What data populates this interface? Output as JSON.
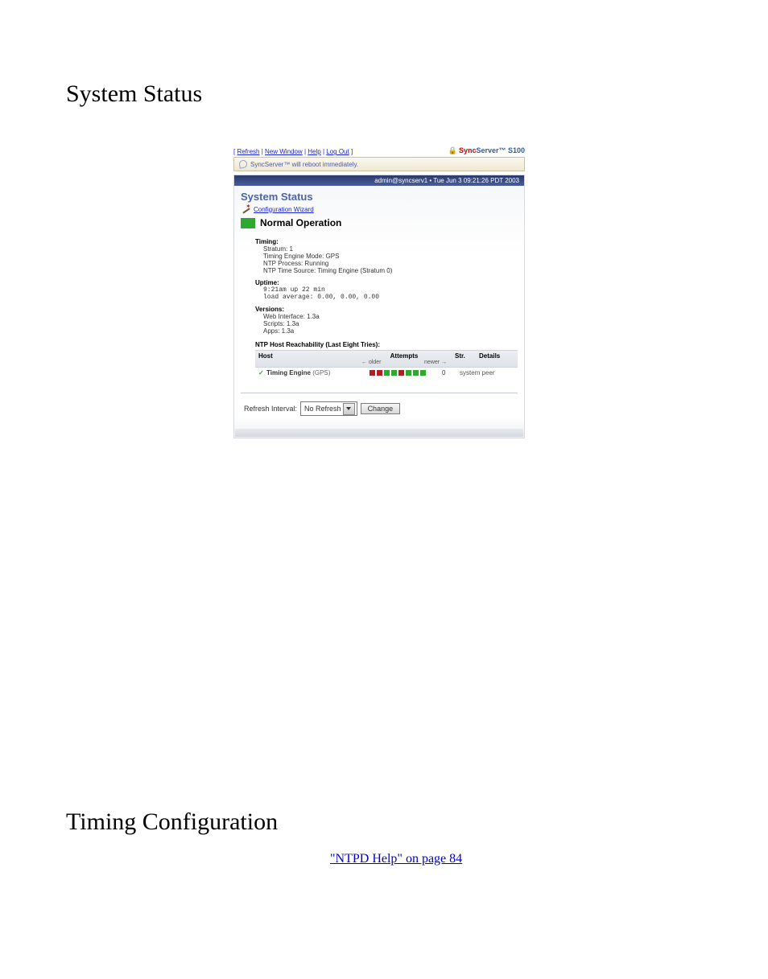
{
  "headings": {
    "system_status": "System Status",
    "timing_configuration": "Timing Configuration"
  },
  "body_link": {
    "text": "\"NTPD Help\" on page 84"
  },
  "shot": {
    "top_links": {
      "lb": "[ ",
      "refresh": "Refresh",
      "sep": " | ",
      "new_window": "New Window",
      "help": "Help",
      "log_out": "Log Out",
      "rb": " ]"
    },
    "brand": {
      "p1": "Sync",
      "p2": "Server™ S100"
    },
    "reboot_msg": "SyncServer™ will reboot immediately.",
    "admin_bar": "admin@syncserv1  •  Tue Jun 3 09:21:26 PDT 2003",
    "title": "System Status",
    "config_wizard": "Configuration Wizard",
    "normal_op": "Normal Operation",
    "timing": {
      "hdg": "Timing:",
      "stratum": "Stratum: 1",
      "mode": "Timing Engine Mode: GPS",
      "proc": "NTP Process: Running",
      "src": "NTP Time Source: Timing Engine (Stratum 0)"
    },
    "uptime": {
      "hdg": "Uptime:",
      "l1": "9:21am  up 22 min",
      "l2": "load average: 0.00, 0.00, 0.00"
    },
    "versions": {
      "hdg": "Versions:",
      "l1": "Web Interface: 1.3a",
      "l2": "Scripts: 1.3a",
      "l3": "Apps: 1.3a"
    },
    "reach": {
      "title": "NTP Host Reachability (Last Eight Tries):",
      "cols": {
        "host": "Host",
        "attempts": "Attempts",
        "str": "Str.",
        "details": "Details"
      },
      "sub": {
        "older": "← older",
        "newer": "newer →"
      },
      "row": {
        "host": "Timing Engine",
        "host_sub": " (GPS)",
        "str": "0",
        "details": "system peer"
      }
    },
    "refresh": {
      "label": "Refresh Interval:",
      "value": "No Refresh",
      "button": "Change"
    }
  },
  "chart_data": {
    "type": "table",
    "title": "NTP Host Reachability (Last Eight Tries)",
    "columns": [
      "Host",
      "Attempts (older→newer)",
      "Str.",
      "Details"
    ],
    "rows": [
      {
        "Host": "Timing Engine (GPS)",
        "Attempts": [
          "fail",
          "fail",
          "ok",
          "ok",
          "fail",
          "ok",
          "ok",
          "ok"
        ],
        "Str.": 0,
        "Details": "system peer"
      }
    ]
  }
}
